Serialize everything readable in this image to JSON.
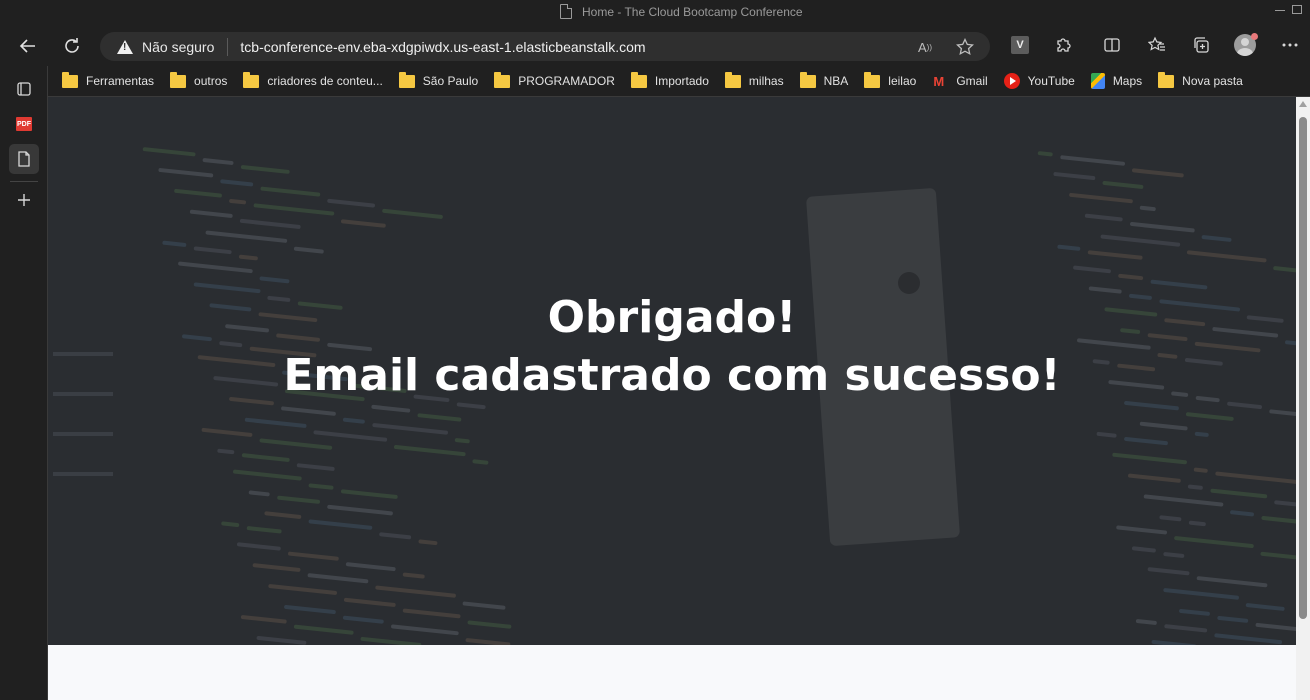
{
  "window": {
    "title": "Home - The Cloud Bootcamp Conference"
  },
  "address_bar": {
    "security_label": "Não seguro",
    "url": "tcb-conference-env.eba-xdgpiwdx.us-east-1.elasticbeanstalk.com",
    "extension_badge": "V"
  },
  "bookmarks": [
    {
      "label": "Ferramentas",
      "icon": "folder-icon"
    },
    {
      "label": "outros",
      "icon": "folder-icon"
    },
    {
      "label": "criadores de conteu...",
      "icon": "folder-icon"
    },
    {
      "label": "São Paulo",
      "icon": "folder-icon"
    },
    {
      "label": "PROGRAMADOR",
      "icon": "folder-icon"
    },
    {
      "label": "Importado",
      "icon": "folder-icon"
    },
    {
      "label": "milhas",
      "icon": "folder-icon"
    },
    {
      "label": "NBA",
      "icon": "folder-icon"
    },
    {
      "label": "leilao",
      "icon": "folder-icon"
    },
    {
      "label": "Gmail",
      "icon": "gmail-icon"
    },
    {
      "label": "YouTube",
      "icon": "youtube-icon"
    },
    {
      "label": "Maps",
      "icon": "maps-icon"
    },
    {
      "label": "Nova pasta",
      "icon": "folder-icon"
    }
  ],
  "sidebar": {
    "pdf_label": "PDF"
  },
  "page": {
    "heading_line1": "Obrigado!",
    "heading_line2": "Email cadastrado com sucesso!"
  },
  "colors": {
    "browser_chrome": "#202020",
    "address_bar": "#2f2f2f",
    "hero_background": "#2a2d31",
    "hero_text": "#ffffff",
    "page_background": "#f8f9fb",
    "folder": "#f5c842"
  }
}
